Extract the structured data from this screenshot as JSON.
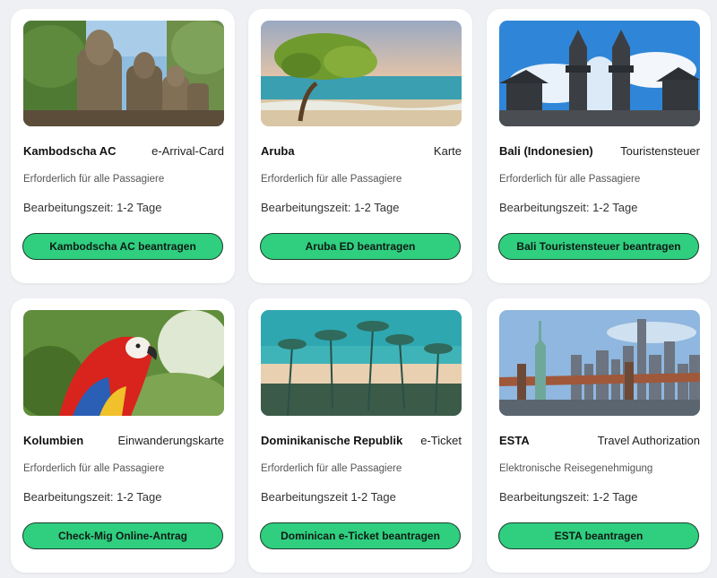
{
  "cards": [
    {
      "image_icon": "angkor-statues-image",
      "name": "Kambodscha AC",
      "type": "e-Arrival-Card",
      "requirement": "Erforderlich für alle Passagiere",
      "processing": "Bearbeitungszeit: 1-2 Tage",
      "button": "Kambodscha AC beantragen"
    },
    {
      "image_icon": "aruba-tree-beach-image",
      "name": "Aruba",
      "type": "Karte",
      "requirement": "Erforderlich für alle Passagiere",
      "processing": "Bearbeitungszeit: 1-2 Tage",
      "button": "Aruba ED beantragen"
    },
    {
      "image_icon": "bali-temple-gate-image",
      "name": "Bali (Indonesien)",
      "type": "Touristensteuer",
      "requirement": "Erforderlich für alle Passagiere",
      "processing": "Bearbeitungszeit: 1-2 Tage",
      "button": "Bali Touristensteuer beantragen"
    },
    {
      "image_icon": "parrot-image",
      "name": "Kolumbien",
      "type": "Einwanderungskarte",
      "requirement": "Erforderlich für alle Passagiere",
      "processing": "Bearbeitungszeit: 1-2 Tage",
      "button": "Check-Mig Online-Antrag"
    },
    {
      "image_icon": "palm-beach-image",
      "name": "Dominikanische Republik",
      "type": "e-Ticket",
      "requirement": "Erforderlich für alle Passagiere",
      "processing": "Bearbeitungszeit 1-2 Tage",
      "button": "Dominican e-Ticket beantragen"
    },
    {
      "image_icon": "statue-of-liberty-skyline-image",
      "name": "ESTA",
      "type": "Travel Authorization",
      "requirement": "Elektronische Reisegenehmigung",
      "processing": "Bearbeitungszeit: 1-2 Tage",
      "button": "ESTA beantragen"
    }
  ],
  "colors": {
    "page_background": "#eef0f3",
    "card_background": "#ffffff",
    "button_green": "#2fcf7f",
    "button_border": "#1a3b2b"
  }
}
